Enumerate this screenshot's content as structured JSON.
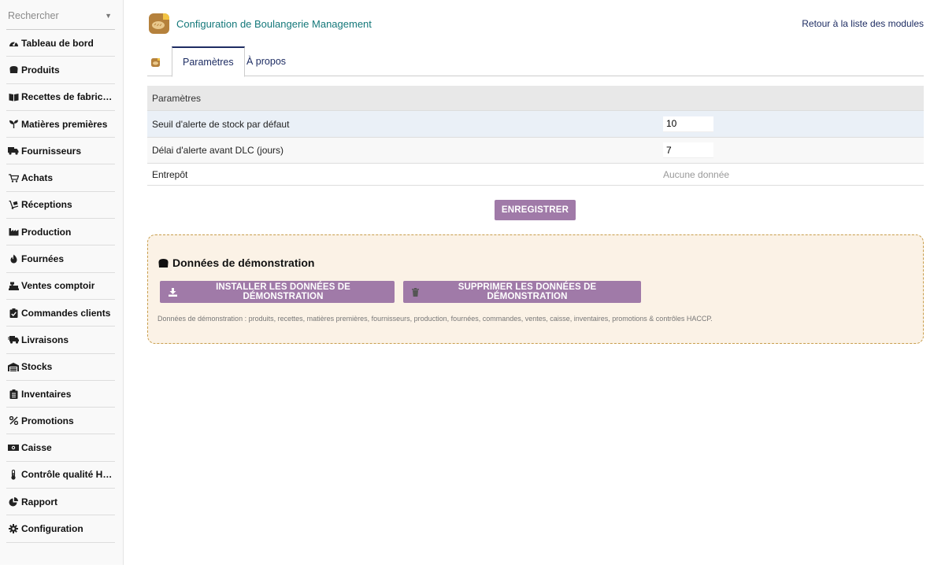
{
  "sidebar": {
    "search_placeholder": "Rechercher",
    "items": [
      {
        "label": "Tableau de bord",
        "icon": "dashboard-icon"
      },
      {
        "label": "Produits",
        "icon": "bread-icon"
      },
      {
        "label": "Recettes de fabrication",
        "icon": "book-icon"
      },
      {
        "label": "Matières premières",
        "icon": "seedling-icon"
      },
      {
        "label": "Fournisseurs",
        "icon": "truck-icon"
      },
      {
        "label": "Achats",
        "icon": "cart-icon"
      },
      {
        "label": "Réceptions",
        "icon": "dolly-icon"
      },
      {
        "label": "Production",
        "icon": "industry-icon"
      },
      {
        "label": "Fournées",
        "icon": "fire-icon"
      },
      {
        "label": "Ventes comptoir",
        "icon": "cash-register-icon"
      },
      {
        "label": "Commandes clients",
        "icon": "clipboard-check-icon"
      },
      {
        "label": "Livraisons",
        "icon": "shipping-fast-icon"
      },
      {
        "label": "Stocks",
        "icon": "warehouse-icon"
      },
      {
        "label": "Inventaires",
        "icon": "clipboard-list-icon"
      },
      {
        "label": "Promotions",
        "icon": "percent-icon"
      },
      {
        "label": "Caisse",
        "icon": "money-bill-icon"
      },
      {
        "label": "Contrôle qualité HACCP",
        "icon": "thermometer-icon"
      },
      {
        "label": "Rapport",
        "icon": "pie-chart-icon"
      },
      {
        "label": "Configuration",
        "icon": "cog-icon"
      }
    ]
  },
  "header": {
    "title": "Configuration de Boulangerie Management",
    "back_link": "Retour à la liste des modules"
  },
  "tabs": [
    {
      "label": "Paramètres",
      "active": true
    },
    {
      "label": "À propos",
      "active": false
    }
  ],
  "settings": {
    "header": "Paramètres",
    "rows": [
      {
        "label": "Seuil d'alerte de stock par défaut",
        "value": "10"
      },
      {
        "label": "Délai d'alerte avant DLC (jours)",
        "value": "7"
      },
      {
        "label": "Entrepôt",
        "value": "Aucune donnée"
      }
    ],
    "save_label": "ENREGISTRER"
  },
  "demo": {
    "title": "Données de démonstration",
    "install_label": "INSTALLER LES DONNÉES DE DÉMONSTRATION",
    "delete_label": "SUPPRIMER LES DONNÉES DE DÉMONSTRATION",
    "note": "Données de démonstration : produits, recettes, matières premières, fournisseurs, production, fournées, commandes, ventes, caisse, inventaires, promotions & contrôles HACCP."
  },
  "colors": {
    "accent_button": "#a07aa8",
    "title_teal": "#14787a",
    "link_navy": "#1e2d63",
    "demo_bg": "#fbf2e6",
    "demo_border": "#c89e4c"
  }
}
